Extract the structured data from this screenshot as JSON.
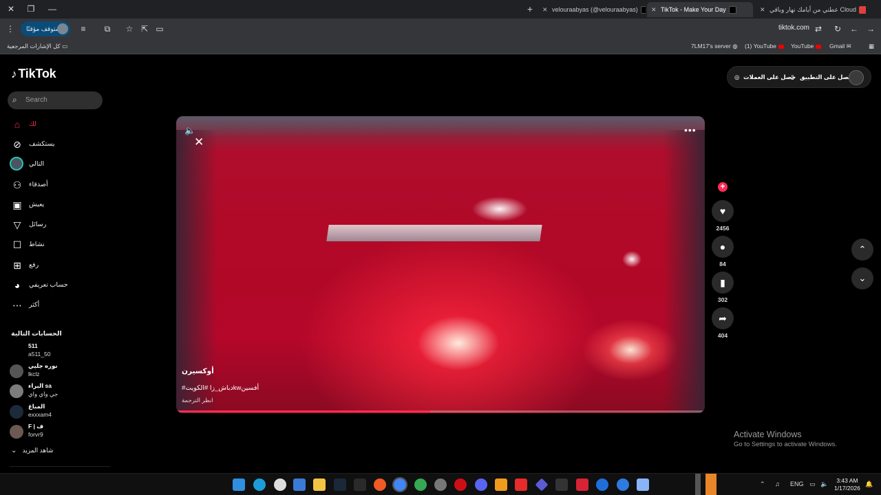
{
  "browser": {
    "tabs": [
      {
        "title": "عطني من أيامك نهار وباقي Cloud",
        "active": false
      },
      {
        "title": "TikTok - Make Your Day",
        "active": true
      },
      {
        "title": "velouraabyas (@velouraabyas)",
        "active": false
      }
    ],
    "url": "tiktok.com",
    "profile_status": "متوقف مؤقتًا",
    "bookmarks": {
      "all_bookmarks": "كل الإشارات المرجعية",
      "items": [
        "Gmail",
        "YouTube",
        "(1) YouTube",
        "7LM17's server"
      ]
    }
  },
  "tiktok": {
    "logo": "TikTok",
    "search_placeholder": "Search",
    "nav": [
      {
        "label": "لك",
        "icon": "home-icon",
        "active": true
      },
      {
        "label": "يستكشف",
        "icon": "compass-icon"
      },
      {
        "label": "التالي",
        "icon": "following-avatar"
      },
      {
        "label": "أصدقاء",
        "icon": "friends-icon"
      },
      {
        "label": "يعيش",
        "icon": "live-icon"
      },
      {
        "label": "رسائل",
        "icon": "messages-icon"
      },
      {
        "label": "نشاط",
        "icon": "activity-icon"
      },
      {
        "label": "رفع",
        "icon": "upload-icon"
      },
      {
        "label": "حساب تعريفي",
        "icon": "profile-avatar"
      },
      {
        "label": "أكثر",
        "icon": "more-icon"
      }
    ],
    "following_title": "الحسابات التالية",
    "following": [
      {
        "name": "511",
        "handle": "a511_50"
      },
      {
        "name": "نوره جليي",
        "handle": "lkclz"
      },
      {
        "name": "البراء sa",
        "handle": "جي واي واي"
      },
      {
        "name": "المباغ",
        "handle": "exxxam4"
      },
      {
        "name": "F | ف",
        "handle": "forvr9"
      }
    ],
    "see_more": "شاهد المزيد",
    "top_actions": {
      "get_coins": "حصل على العملات",
      "get_app": "حصل على التطبيق"
    },
    "video": {
      "author": "أوكسيرن",
      "caption": "#دباش_زا #الكويتkwأفسين",
      "translate": "انظر الترجمة",
      "progress": 0.48
    },
    "actions": {
      "likes": "2456",
      "comments": "84",
      "saves": "302",
      "shares": "404"
    }
  },
  "windows": {
    "activate_title": "Activate Windows",
    "activate_sub": "Go to Settings to activate Windows.",
    "lang": "ENG",
    "time": "3:43 AM",
    "date": "1/17/2026"
  }
}
